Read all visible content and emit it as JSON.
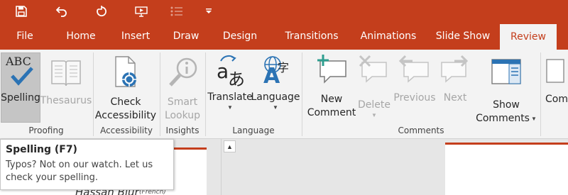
{
  "colors": {
    "brand": "#c43e1c",
    "ribbon_bg": "#f3f3f3",
    "workspace_bg": "#e6e6e6",
    "icon_blue": "#2b73b4"
  },
  "quick_access": [
    {
      "icon": "save-icon"
    },
    {
      "icon": "undo-icon"
    },
    {
      "icon": "redo-icon"
    },
    {
      "icon": "start-from-beginning-icon"
    },
    {
      "icon": "bullets-icon"
    },
    {
      "icon": "customize-qat-icon"
    }
  ],
  "tabs": [
    {
      "label": "File"
    },
    {
      "label": "Home"
    },
    {
      "label": "Insert"
    },
    {
      "label": "Draw"
    },
    {
      "label": "Design"
    },
    {
      "label": "Transitions"
    },
    {
      "label": "Animations"
    },
    {
      "label": "Slide Show"
    },
    {
      "label": "Review",
      "active": true
    }
  ],
  "ribbon": {
    "proofing": {
      "label": "Proofing",
      "spelling": {
        "label": "Spelling",
        "icon": "spelling-abc-icon",
        "icon_text": "ABC"
      },
      "thesaurus": {
        "label": "Thesaurus",
        "icon": "thesaurus-book-icon"
      }
    },
    "accessibility": {
      "label": "Accessibility",
      "check": {
        "line1": "Check",
        "line2": "Accessibility",
        "icon": "check-accessibility-icon"
      }
    },
    "insights": {
      "label": "Insights",
      "smart_lookup": {
        "line1": "Smart",
        "line2": "Lookup",
        "icon": "smart-lookup-icon"
      }
    },
    "language": {
      "label": "Language",
      "translate": {
        "label": "Translate",
        "icon": "translate-icon",
        "icon_a": "a",
        "icon_b": "あ"
      },
      "language": {
        "label": "Language",
        "icon": "language-icon",
        "icon_a": "A",
        "icon_b": "字"
      }
    },
    "comments": {
      "label": "Comments",
      "new_comment": {
        "line1": "New",
        "line2": "Comment",
        "icon": "new-comment-icon"
      },
      "delete": {
        "label": "Delete",
        "icon": "delete-comment-icon"
      },
      "previous": {
        "label": "Previous",
        "icon": "previous-comment-icon"
      },
      "next": {
        "label": "Next",
        "icon": "next-comment-icon"
      },
      "show_comments": {
        "line1": "Show",
        "line2": "Comments",
        "icon": "show-comments-icon"
      }
    },
    "compare": {
      "label": "Com"
    }
  },
  "tooltip": {
    "title": "Spelling (F7)",
    "line1": "Typos? Not on our watch. Let us",
    "line2": "check your spelling."
  },
  "slide": {
    "author": "Hassan Blur",
    "author_note": "(French)"
  }
}
